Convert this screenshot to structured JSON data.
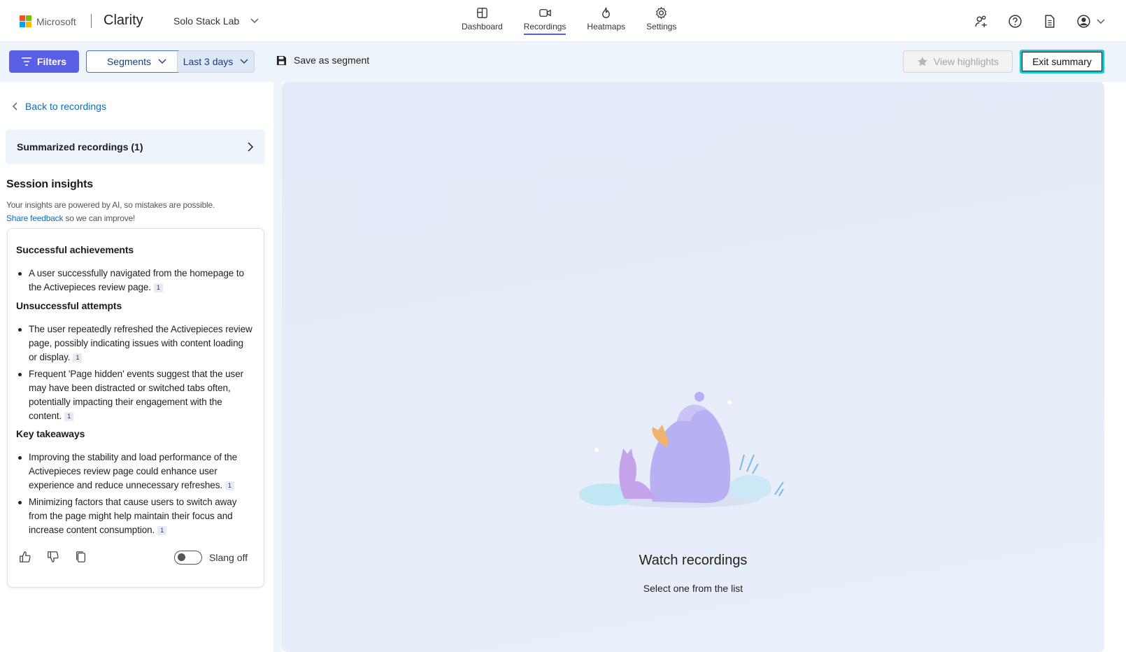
{
  "header": {
    "ms_logo_text": "Microsoft",
    "brand": "Clarity",
    "project": "Solo Stack Lab",
    "nav": [
      {
        "label": "Dashboard",
        "icon": "dashboard-icon"
      },
      {
        "label": "Recordings",
        "icon": "video-camera-icon",
        "active": true
      },
      {
        "label": "Heatmaps",
        "icon": "flame-icon"
      },
      {
        "label": "Settings",
        "icon": "gear-icon"
      }
    ]
  },
  "toolbar": {
    "filters_label": "Filters",
    "segments_label": "Segments",
    "date_range": "Last 3 days",
    "save_segment_label": "Save as segment",
    "view_highlights_label": "View highlights",
    "exit_summary_label": "Exit summary"
  },
  "sidebar": {
    "back_label": "Back to recordings",
    "summarized_label": "Summarized recordings (1)",
    "insights_title": "Session insights",
    "disclaimer_line1": "Your insights are powered by AI, so mistakes are possible.",
    "feedback_link": "Share feedback",
    "disclaimer_line2": "so we can improve!",
    "sections": [
      {
        "title": "Successful achievements",
        "items": [
          {
            "text": "A user successfully navigated from the homepage to the Activepieces review page.",
            "cite": "1"
          }
        ]
      },
      {
        "title": "Unsuccessful attempts",
        "items": [
          {
            "text": "The user repeatedly refreshed the Activepieces review page, possibly indicating issues with content loading or display.",
            "cite": "1"
          },
          {
            "text": "Frequent 'Page hidden' events suggest that the user may have been distracted or switched tabs often, potentially impacting their engagement with the content.",
            "cite": "1"
          }
        ]
      },
      {
        "title": "Key takeaways",
        "items": [
          {
            "text": "Improving the stability and load performance of the Activepieces review page could enhance user experience and reduce unnecessary refreshes.",
            "cite": "1"
          },
          {
            "text": "Minimizing factors that cause users to switch away from the page might help maintain their focus and increase content consumption.",
            "cite": "1"
          }
        ]
      }
    ],
    "slang_label": "Slang off",
    "slang_on": false
  },
  "main": {
    "empty_title": "Watch recordings",
    "empty_subtitle": "Select one from the list"
  },
  "colors": {
    "accent": "#5b5fe6",
    "link": "#0f6cbd",
    "focus_ring": "#1fc3d0",
    "toolbar_bg": "#eef4fb"
  }
}
